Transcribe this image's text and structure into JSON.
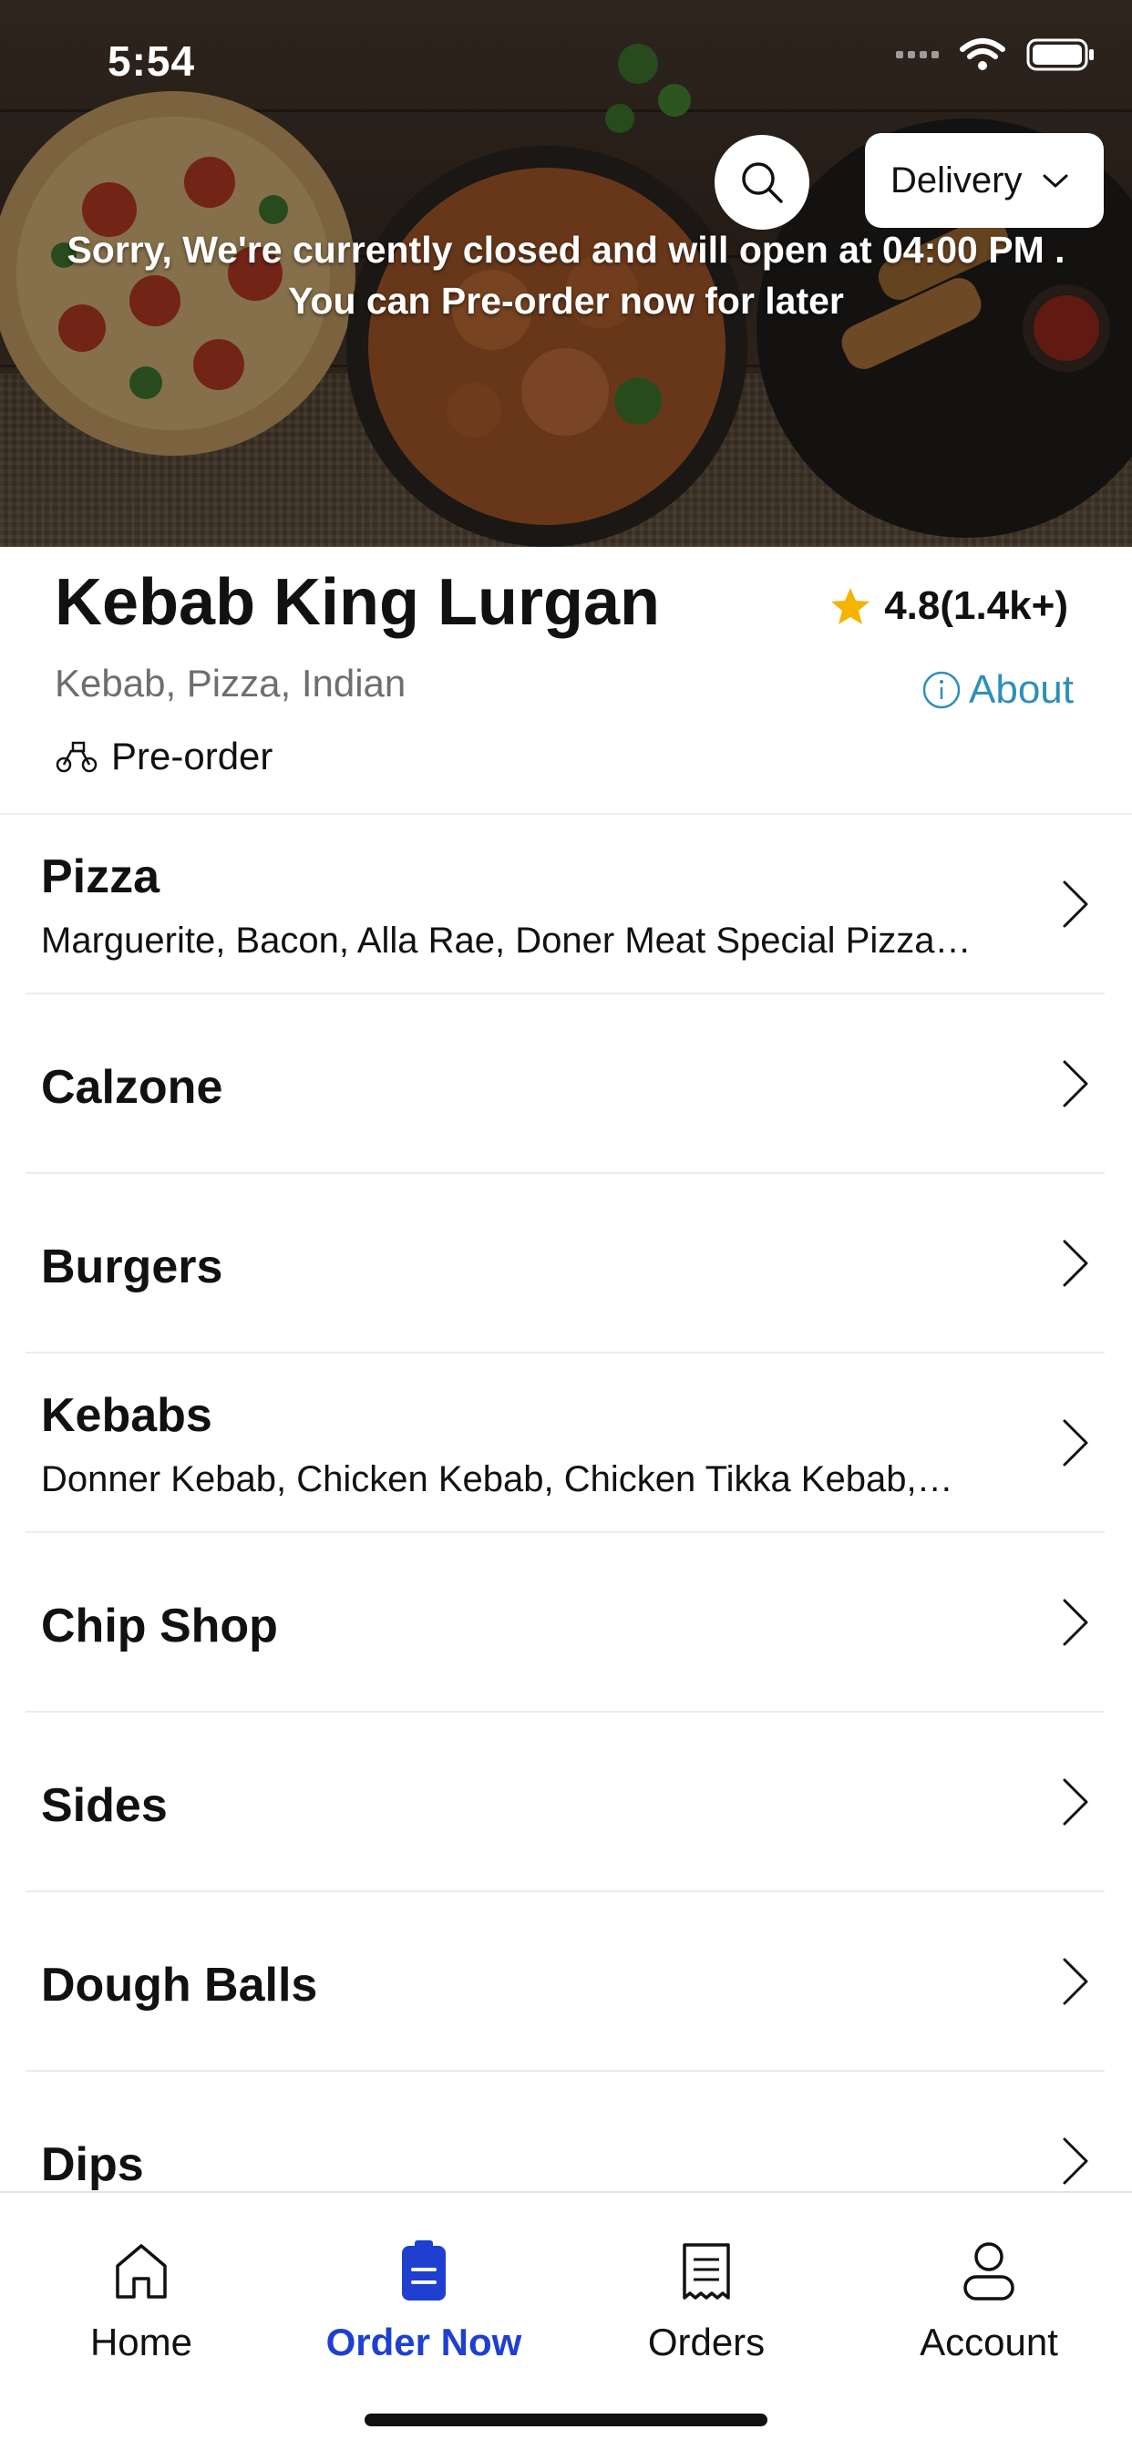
{
  "status_bar": {
    "time": "5:54"
  },
  "hero": {
    "delivery_label": "Delivery",
    "closed_line1": "Sorry, We're currently closed and will open at 04:00 PM .",
    "closed_line2": "You can Pre-order now for later"
  },
  "restaurant": {
    "name": "Kebab King Lurgan",
    "rating": "4.8(1.4k+)",
    "cuisine": "Kebab, Pizza, Indian",
    "about_label": "About",
    "preorder_label": "Pre-order"
  },
  "categories": [
    {
      "title": "Pizza",
      "subtitle": "Marguerite, Bacon, Alla Rae, Doner Meat Special Pizza…"
    },
    {
      "title": "Calzone",
      "subtitle": ""
    },
    {
      "title": "Burgers",
      "subtitle": ""
    },
    {
      "title": "Kebabs",
      "subtitle": "Donner Kebab, Chicken Kebab, Chicken Tikka Kebab,…"
    },
    {
      "title": "Chip Shop",
      "subtitle": ""
    },
    {
      "title": "Sides",
      "subtitle": ""
    },
    {
      "title": "Dough Balls",
      "subtitle": ""
    },
    {
      "title": "Dips",
      "subtitle": ""
    }
  ],
  "tabbar": {
    "home": "Home",
    "order_now": "Order Now",
    "orders": "Orders",
    "account": "Account"
  },
  "colors": {
    "accent": "#1f3fd1",
    "link": "#2f8fb8",
    "star": "#f5b400"
  }
}
